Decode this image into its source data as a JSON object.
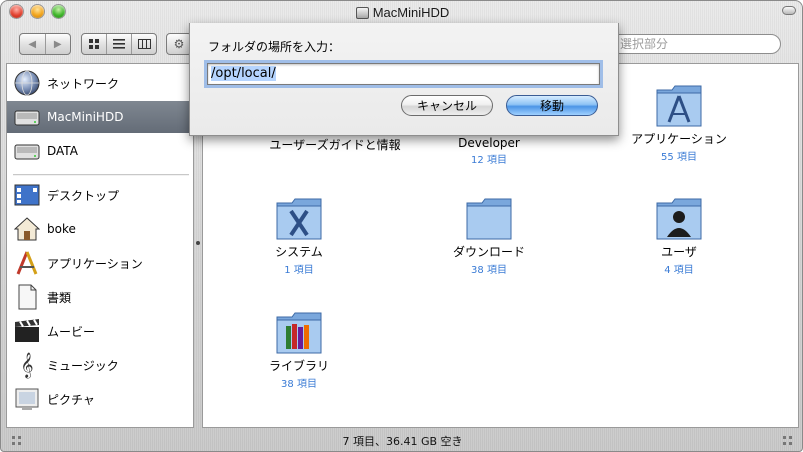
{
  "window": {
    "title": "MacMiniHDD"
  },
  "toolbar": {
    "search_placeholder": "選択部分"
  },
  "sidebar": {
    "devices": [
      {
        "label": "ネットワーク",
        "icon": "network-globe-icon"
      },
      {
        "label": "MacMiniHDD",
        "icon": "hard-disk-icon",
        "selected": true
      },
      {
        "label": "DATA",
        "icon": "hard-disk-icon"
      }
    ],
    "places": [
      {
        "label": "デスクトップ",
        "icon": "desktop-icon"
      },
      {
        "label": "boke",
        "icon": "home-icon"
      },
      {
        "label": "アプリケーション",
        "icon": "applications-icon"
      },
      {
        "label": "書類",
        "icon": "documents-icon"
      },
      {
        "label": "ムービー",
        "icon": "movies-icon"
      },
      {
        "label": "ミュージック",
        "icon": "music-icon"
      },
      {
        "label": "ピクチャ",
        "icon": "pictures-icon"
      }
    ]
  },
  "items": [
    {
      "name": "ユーザーズガイドと情報",
      "count": "",
      "icon": "folder-icon"
    },
    {
      "name": "Developer",
      "count": "12 項目",
      "icon": "folder-icon"
    },
    {
      "name": "アプリケーション",
      "count": "55 項目",
      "icon": "applications-folder-icon"
    },
    {
      "name": "システム",
      "count": "1 項目",
      "icon": "system-folder-icon"
    },
    {
      "name": "ダウンロード",
      "count": "38 項目",
      "icon": "folder-icon"
    },
    {
      "name": "ユーザ",
      "count": "4 項目",
      "icon": "users-folder-icon"
    },
    {
      "name": "ライブラリ",
      "count": "38 項目",
      "icon": "library-folder-icon"
    }
  ],
  "status": {
    "text": "7 項目、36.41 GB 空き"
  },
  "dialog": {
    "label": "フォルダの場所を入力：",
    "value": "/opt/local/",
    "cancel_label": "キャンセル",
    "go_label": "移動"
  },
  "colors": {
    "selection": "#6b737d",
    "count_text": "#3a7bd5",
    "default_button": "#4c95e6"
  }
}
